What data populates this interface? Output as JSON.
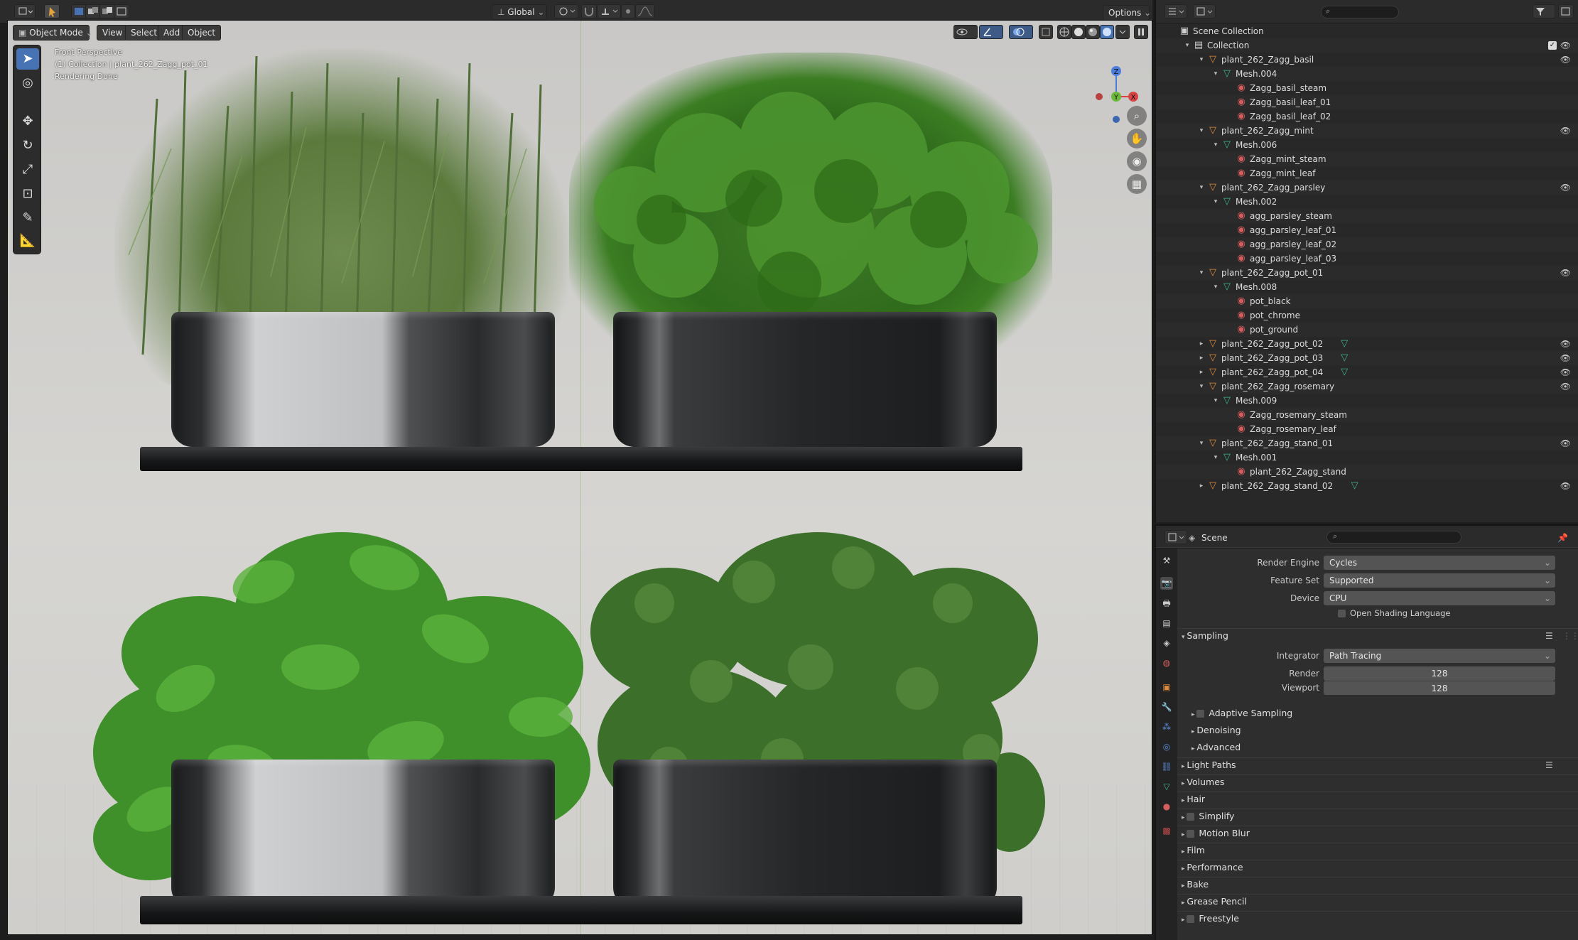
{
  "topbar": {
    "orientation": "Global",
    "options": "Options"
  },
  "viewport_header": {
    "mode": "Object Mode",
    "menus": [
      "View",
      "Select",
      "Add",
      "Object"
    ]
  },
  "viewport": {
    "overlay_lines": [
      "Front Perspective",
      "(1) Collection | plant_262_Zagg_pot_01",
      "Rendering Done"
    ],
    "gizmo_axes": [
      "Z",
      "Y",
      "X"
    ]
  },
  "outliner": {
    "rows": [
      {
        "label": "Scene Collection",
        "indent": 0,
        "icon": "scene-collection-icon",
        "color": "#dcdcdc",
        "tri": "",
        "eye": false,
        "check": false
      },
      {
        "label": "Collection",
        "indent": 1,
        "icon": "collection-icon",
        "color": "#dcdcdc",
        "tri": "▾",
        "eye": true,
        "check": true
      },
      {
        "label": "plant_262_Zagg_basil",
        "indent": 2,
        "icon": "object-icon",
        "tri": "▾",
        "eye": true
      },
      {
        "label": "Mesh.004",
        "indent": 3,
        "icon": "mesh-icon",
        "tri": "▾",
        "eye": false
      },
      {
        "label": "Zagg_basil_steam",
        "indent": 4,
        "icon": "material-icon",
        "tri": "",
        "eye": false
      },
      {
        "label": "Zagg_basil_leaf_01",
        "indent": 4,
        "icon": "material-icon",
        "tri": "",
        "eye": false
      },
      {
        "label": "Zagg_basil_leaf_02",
        "indent": 4,
        "icon": "material-icon",
        "tri": "",
        "eye": false
      },
      {
        "label": "plant_262_Zagg_mint",
        "indent": 2,
        "icon": "object-icon",
        "tri": "▾",
        "eye": true
      },
      {
        "label": "Mesh.006",
        "indent": 3,
        "icon": "mesh-icon",
        "tri": "▾",
        "eye": false
      },
      {
        "label": "Zagg_mint_steam",
        "indent": 4,
        "icon": "material-icon",
        "tri": "",
        "eye": false
      },
      {
        "label": "Zagg_mint_leaf",
        "indent": 4,
        "icon": "material-icon",
        "tri": "",
        "eye": false
      },
      {
        "label": "plant_262_Zagg_parsley",
        "indent": 2,
        "icon": "object-icon",
        "tri": "▾",
        "eye": true
      },
      {
        "label": "Mesh.002",
        "indent": 3,
        "icon": "mesh-icon",
        "tri": "▾",
        "eye": false
      },
      {
        "label": "agg_parsley_steam",
        "indent": 4,
        "icon": "material-icon",
        "tri": "",
        "eye": false
      },
      {
        "label": "agg_parsley_leaf_01",
        "indent": 4,
        "icon": "material-icon",
        "tri": "",
        "eye": false
      },
      {
        "label": "agg_parsley_leaf_02",
        "indent": 4,
        "icon": "material-icon",
        "tri": "",
        "eye": false
      },
      {
        "label": "agg_parsley_leaf_03",
        "indent": 4,
        "icon": "material-icon",
        "tri": "",
        "eye": false
      },
      {
        "label": "plant_262_Zagg_pot_01",
        "indent": 2,
        "icon": "object-icon",
        "tri": "▾",
        "eye": true
      },
      {
        "label": "Mesh.008",
        "indent": 3,
        "icon": "mesh-icon",
        "tri": "▾",
        "eye": false
      },
      {
        "label": "pot_black",
        "indent": 4,
        "icon": "material-icon",
        "tri": "",
        "eye": false
      },
      {
        "label": "pot_chrome",
        "indent": 4,
        "icon": "material-icon",
        "tri": "",
        "eye": false
      },
      {
        "label": "pot_ground",
        "indent": 4,
        "icon": "material-icon",
        "tri": "",
        "eye": false
      },
      {
        "label": "plant_262_Zagg_pot_02",
        "indent": 2,
        "icon": "object-icon",
        "tri": "▸",
        "eye": true,
        "mesh_badge": true
      },
      {
        "label": "plant_262_Zagg_pot_03",
        "indent": 2,
        "icon": "object-icon",
        "tri": "▸",
        "eye": true,
        "mesh_badge": true
      },
      {
        "label": "plant_262_Zagg_pot_04",
        "indent": 2,
        "icon": "object-icon",
        "tri": "▸",
        "eye": true,
        "mesh_badge": true
      },
      {
        "label": "plant_262_Zagg_rosemary",
        "indent": 2,
        "icon": "object-icon",
        "tri": "▾",
        "eye": true
      },
      {
        "label": "Mesh.009",
        "indent": 3,
        "icon": "mesh-icon",
        "tri": "▾",
        "eye": false
      },
      {
        "label": "Zagg_rosemary_steam",
        "indent": 4,
        "icon": "material-icon",
        "tri": "",
        "eye": false
      },
      {
        "label": "Zagg_rosemary_leaf",
        "indent": 4,
        "icon": "material-icon",
        "tri": "",
        "eye": false
      },
      {
        "label": "plant_262_Zagg_stand_01",
        "indent": 2,
        "icon": "object-icon",
        "tri": "▾",
        "eye": true
      },
      {
        "label": "Mesh.001",
        "indent": 3,
        "icon": "mesh-icon",
        "tri": "▾",
        "eye": false
      },
      {
        "label": "plant_262_Zagg_stand",
        "indent": 4,
        "icon": "material-icon",
        "tri": "",
        "eye": false
      },
      {
        "label": "plant_262_Zagg_stand_02",
        "indent": 2,
        "icon": "object-icon",
        "tri": "▸",
        "eye": true,
        "mesh_badge": true
      }
    ]
  },
  "properties": {
    "context": "Scene",
    "render_engine_label": "Render Engine",
    "render_engine": "Cycles",
    "feature_set_label": "Feature Set",
    "feature_set": "Supported",
    "device_label": "Device",
    "device": "CPU",
    "osl": "Open Shading Language",
    "sampling": "Sampling",
    "integrator_label": "Integrator",
    "integrator": "Path Tracing",
    "render_label": "Render",
    "render_samples": "128",
    "viewport_label": "Viewport",
    "viewport_samples": "128",
    "sub_sections": [
      "Adaptive Sampling",
      "Denoising",
      "Advanced"
    ],
    "sections": [
      "Light Paths",
      "Volumes",
      "Hair",
      "Simplify",
      "Motion Blur",
      "Film",
      "Performance",
      "Bake",
      "Grease Pencil",
      "Freestyle"
    ]
  },
  "colors": {
    "accent": "#4772b3",
    "object": "#e08a3c",
    "mesh": "#3fb58a",
    "material": "#d65d5d"
  }
}
